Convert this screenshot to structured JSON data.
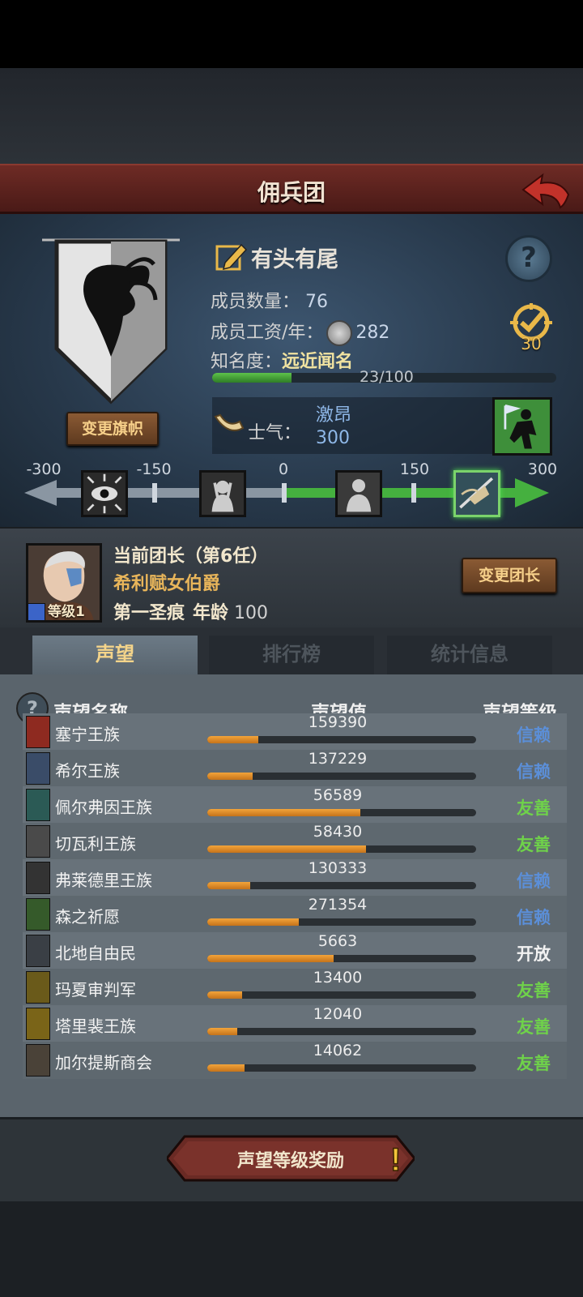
{
  "header": {
    "title": "佣兵团"
  },
  "company": {
    "name": "有头有尾",
    "members_label": "成员数量：",
    "members_value": "76",
    "wage_label": "成员工资/年：",
    "wage_value": "282",
    "fame_label": "知名度：",
    "fame_value": "远近闻名",
    "fame_progress_text": "23/100",
    "fame_progress": 0.23,
    "badge_value": "30",
    "change_flag_label": "变更旗帜"
  },
  "morale": {
    "label": "士气：",
    "state": "激昂",
    "value": "300",
    "scale_labels": [
      "-300",
      "-150",
      "0",
      "150",
      "300"
    ],
    "current": 300
  },
  "leader": {
    "title": "当前团长（第6任）",
    "name": "希利赋女伯爵",
    "level_label": "等级1",
    "trait": "第一圣痕",
    "age_label": "年龄",
    "age_value": "100",
    "change_label": "变更团长"
  },
  "tabs": [
    {
      "label": "声望",
      "active": true
    },
    {
      "label": "排行榜",
      "active": false
    },
    {
      "label": "统计信息",
      "active": false
    }
  ],
  "table": {
    "headers": {
      "name": "声望名称",
      "value": "声望值",
      "level": "声望等级"
    },
    "rows": [
      {
        "name": "塞宁王族",
        "value": "159390",
        "level": "信赖",
        "progress": 0.19,
        "emblem_color": "#8e2a20"
      },
      {
        "name": "希尔王族",
        "value": "137229",
        "level": "信赖",
        "progress": 0.17,
        "emblem_color": "#3a4c68"
      },
      {
        "name": "佩尔弗因王族",
        "value": "56589",
        "level": "友善",
        "progress": 0.57,
        "emblem_color": "#2b5a55"
      },
      {
        "name": "切瓦利王族",
        "value": "58430",
        "level": "友善",
        "progress": 0.59,
        "emblem_color": "#4a4a4a"
      },
      {
        "name": "弗莱德里王族",
        "value": "130333",
        "level": "信赖",
        "progress": 0.16,
        "emblem_color": "#333333"
      },
      {
        "name": "森之祈愿",
        "value": "271354",
        "level": "信赖",
        "progress": 0.34,
        "emblem_color": "#355a2a"
      },
      {
        "name": "北地自由民",
        "value": "5663",
        "level": "开放",
        "progress": 0.47,
        "emblem_color": "#3a3f45"
      },
      {
        "name": "玛夏审判军",
        "value": "13400",
        "level": "友善",
        "progress": 0.13,
        "emblem_color": "#6a5a1a"
      },
      {
        "name": "塔里裴王族",
        "value": "12040",
        "level": "友善",
        "progress": 0.11,
        "emblem_color": "#7a6418"
      },
      {
        "name": "加尔提斯商会",
        "value": "14062",
        "level": "友善",
        "progress": 0.14,
        "emblem_color": "#4a4238"
      }
    ],
    "level_colors": {
      "信赖": "#5b8fd9",
      "友善": "#6fd24a",
      "开放": "#f2f2f2"
    }
  },
  "footer": {
    "reward_label": "声望等级奖励"
  }
}
